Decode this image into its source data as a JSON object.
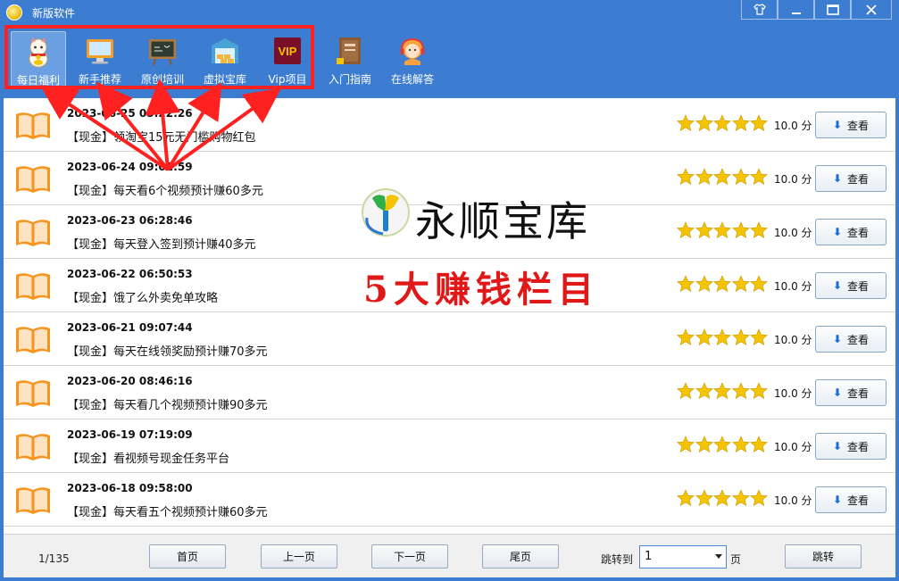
{
  "window": {
    "title": "新版软件"
  },
  "toolbar": {
    "items": [
      {
        "label": "每日福利",
        "icon": "lucky-cat-icon",
        "active": true
      },
      {
        "label": "新手推荐",
        "icon": "monitor-icon"
      },
      {
        "label": "原创培训",
        "icon": "blackboard-icon"
      },
      {
        "label": "虚拟宝库",
        "icon": "warehouse-icon"
      },
      {
        "label": "Vip项目",
        "icon": "vip-icon",
        "badge": "VIP"
      },
      {
        "label": "入门指南",
        "icon": "guide-book-icon"
      },
      {
        "label": "在线解答",
        "icon": "support-agent-icon"
      }
    ]
  },
  "list": {
    "rows": [
      {
        "date": "2023-06-25 05:22:26",
        "title": "【现金】领淘宝15元无门槛购物红包",
        "score": "10.0 分",
        "button": "查看"
      },
      {
        "date": "2023-06-24 09:02:59",
        "title": "【现金】每天看6个视频预计赚60多元",
        "score": "10.0 分",
        "button": "查看"
      },
      {
        "date": "2023-06-23 06:28:46",
        "title": "【现金】每天登入签到预计赚40多元",
        "score": "10.0 分",
        "button": "查看"
      },
      {
        "date": "2023-06-22 06:50:53",
        "title": "【现金】饿了么外卖免单攻略",
        "score": "10.0 分",
        "button": "查看"
      },
      {
        "date": "2023-06-21 09:07:44",
        "title": "【现金】每天在线领奖励预计赚70多元",
        "score": "10.0 分",
        "button": "查看"
      },
      {
        "date": "2023-06-20 08:46:16",
        "title": "【现金】每天看几个视频预计赚90多元",
        "score": "10.0 分",
        "button": "查看"
      },
      {
        "date": "2023-06-19 07:19:09",
        "title": "【现金】看视频号现金任务平台",
        "score": "10.0 分",
        "button": "查看"
      },
      {
        "date": "2023-06-18 09:58:00",
        "title": "【现金】每天看五个视频预计赚60多元",
        "score": "10.0 分",
        "button": "查看"
      }
    ],
    "rating_stars": 5
  },
  "pager": {
    "page_indicator": "1/135",
    "first": "首页",
    "prev": "上一页",
    "next": "下一页",
    "last": "尾页",
    "jump_label": "跳转到",
    "page_value": "1",
    "unit": "页",
    "go": "跳转"
  },
  "overlay": {
    "brand_name": "永顺宝库",
    "slogan": "5大赚钱栏目"
  },
  "colors": {
    "chrome_blue": "#3c7dd2",
    "highlight_red": "#ff2020",
    "star_yellow": "#f5c400",
    "slogan_red": "#e11818"
  }
}
